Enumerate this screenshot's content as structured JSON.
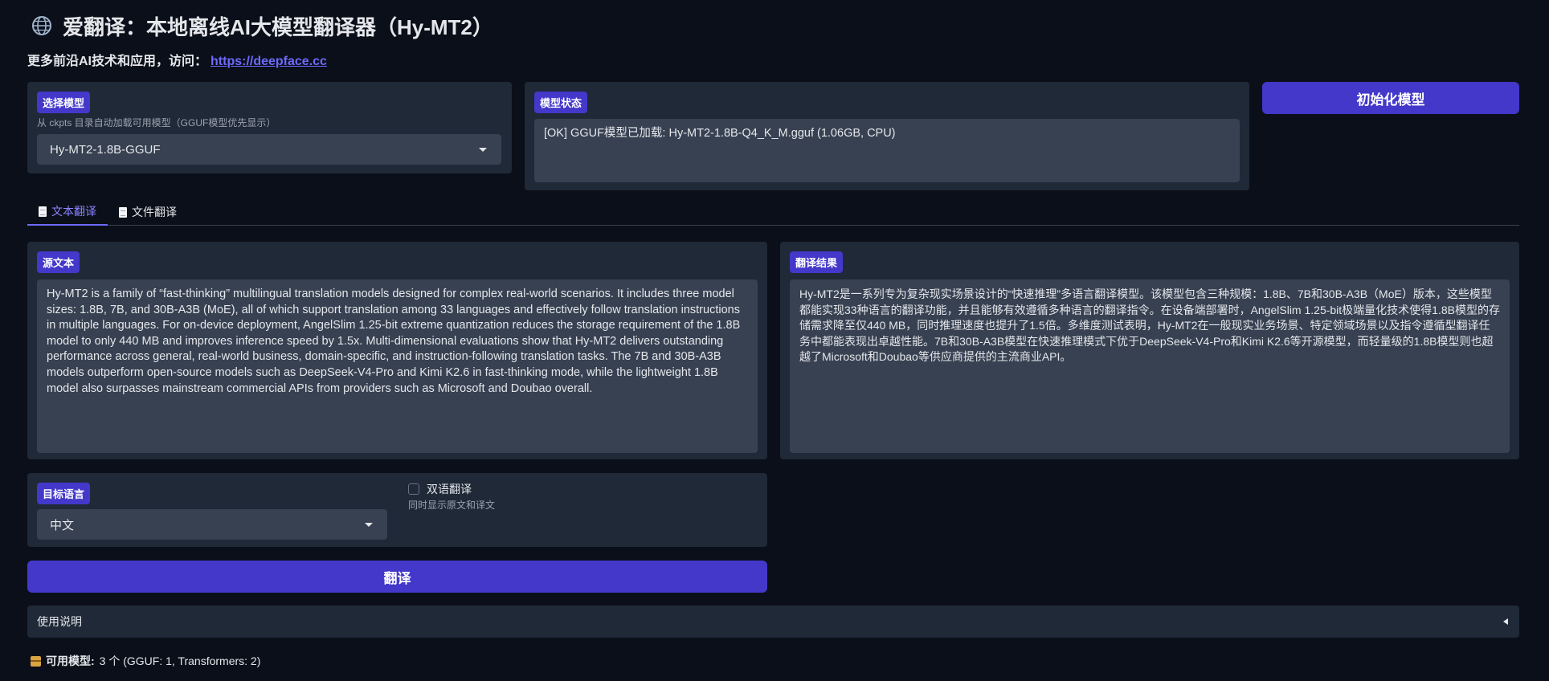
{
  "header": {
    "title": "爱翻译：本地离线AI大模型翻译器（Hy-MT2）",
    "subtitle_prefix": "更多前沿AI技术和应用，访问：",
    "subtitle_link": "https://deepface.cc"
  },
  "model_select": {
    "label": "选择模型",
    "hint": "从 ckpts 目录自动加载可用模型（GGUF模型优先显示）",
    "value": "Hy-MT2-1.8B-GGUF"
  },
  "model_status": {
    "label": "模型状态",
    "value": "[OK] GGUF模型已加载: Hy-MT2-1.8B-Q4_K_M.gguf (1.06GB, CPU)"
  },
  "init_button": {
    "label": "初始化模型"
  },
  "tabs": [
    {
      "label": "文本翻译",
      "active": true
    },
    {
      "label": "文件翻译",
      "active": false
    }
  ],
  "source": {
    "label": "源文本",
    "text": "Hy-MT2 is a family of “fast-thinking” multilingual translation models designed for complex real-world scenarios. It includes three model sizes: 1.8B, 7B, and 30B-A3B (MoE), all of which support translation among 33 languages and effectively follow translation instructions in multiple languages. For on-device deployment, AngelSlim 1.25-bit extreme quantization reduces the storage requirement of the 1.8B model to only 440 MB and improves inference speed by 1.5x. Multi-dimensional evaluations show that Hy-MT2 delivers outstanding performance across general, real-world business, domain-specific, and instruction-following translation tasks. The 7B and 30B-A3B models outperform open-source models such as DeepSeek-V4-Pro and Kimi K2.6 in fast-thinking mode, while the lightweight 1.8B model also surpasses mainstream commercial APIs from providers such as Microsoft and Doubao overall."
  },
  "result": {
    "label": "翻译结果",
    "text": "Hy-MT2是一系列专为复杂现实场景设计的“快速推理”多语言翻译模型。该模型包含三种规模：1.8B、7B和30B-A3B（MoE）版本，这些模型都能实现33种语言的翻译功能，并且能够有效遵循多种语言的翻译指令。在设备端部署时，AngelSlim 1.25-bit极端量化技术使得1.8B模型的存储需求降至仅440 MB，同时推理速度也提升了1.5倍。多维度测试表明，Hy-MT2在一般现实业务场景、特定领域场景以及指令遵循型翻译任务中都能表现出卓越性能。7B和30B-A3B模型在快速推理模式下优于DeepSeek-V4-Pro和Kimi K2.6等开源模型，而轻量级的1.8B模型则也超越了Microsoft和Doubao等供应商提供的主流商业API。"
  },
  "target_language": {
    "label": "目标语言",
    "value": "中文"
  },
  "bilingual": {
    "label": "双语翻译",
    "hint": "同时显示原文和译文",
    "checked": false
  },
  "translate_button": {
    "label": "翻译"
  },
  "usage": {
    "label": "使用说明"
  },
  "footer": {
    "available_label": "可用模型:",
    "available_value": "3 个 (GGUF: 1, Transformers: 2)"
  },
  "colors": {
    "background": "#0b0f19",
    "panel": "#1f2937",
    "input": "#374151",
    "accent": "#4338ca",
    "link": "#6d6afc"
  }
}
